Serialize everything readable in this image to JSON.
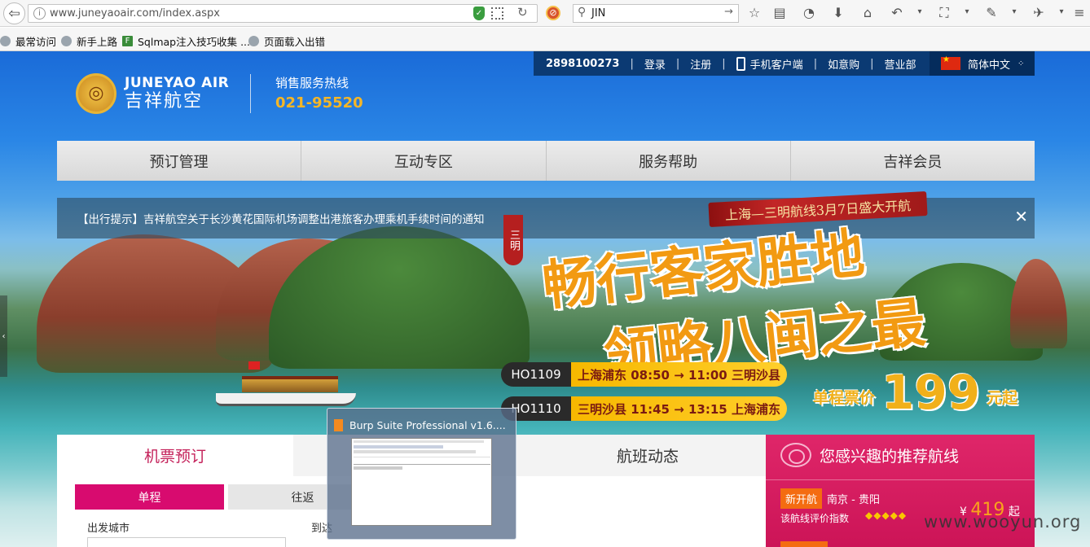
{
  "browser": {
    "url": "www.juneyaoair.com/index.aspx",
    "search_value": "JIN",
    "bookmarks": [
      "最常访问",
      "新手上路",
      "Sqlmap注入技巧收集 ...",
      "页面载入出错"
    ]
  },
  "site": {
    "topbar": {
      "hotline_id": "2898100273",
      "login": "登录",
      "register": "注册",
      "mobile": "手机客户端",
      "ruyigou": "如意购",
      "office": "营业部",
      "language": "简体中文"
    },
    "logo": {
      "en": "JUNEYAO AIR",
      "cn": "吉祥航空"
    },
    "hotline": {
      "label": "销售服务热线",
      "number": "021-95520"
    },
    "nav": [
      "预订管理",
      "互动专区",
      "服务帮助",
      "吉祥会员"
    ],
    "notice": "【出行提示】吉祥航空关于长沙黄花国际机场调整出港旅客办理乘机手续时间的通知",
    "banner": {
      "ribbon": "上海—三明航线3月7日盛大开航",
      "tag": "三明",
      "slogan1": "畅行客家胜地",
      "slogan2": "领略八闽之最",
      "flights": [
        {
          "code": "HO1109",
          "info": "上海浦东 08:50 → 11:00 三明沙县"
        },
        {
          "code": "HO1110",
          "info": "三明沙县 11:45 → 13:15 上海浦东"
        }
      ],
      "fare_label": "单程票价",
      "fare_value": "199",
      "fare_suffix": "元起"
    },
    "booking": {
      "tabs": [
        "机票预订",
        "",
        "航班动态"
      ],
      "one_way": "单程",
      "round_trip": "往返",
      "depart_label": "出发城市",
      "arrive_label": "到达"
    },
    "recommend": {
      "title": "您感兴趣的推荐航线",
      "new_tag": "新开航",
      "route": "南京 - 贵阳",
      "rating_label": "该航线评价指数",
      "stars": "◆◆◆◆◆",
      "currency": "¥",
      "price": "419",
      "price_suffix": "起"
    }
  },
  "taskbar_preview": {
    "title": "Burp Suite Professional v1.6...."
  },
  "watermark": "www.wooyun.org",
  "colors": {
    "nav_accent": "#c4215a",
    "recommend_bg": "#cc1457",
    "fare": "#f1b01a",
    "topbar": "#0b3a73"
  }
}
